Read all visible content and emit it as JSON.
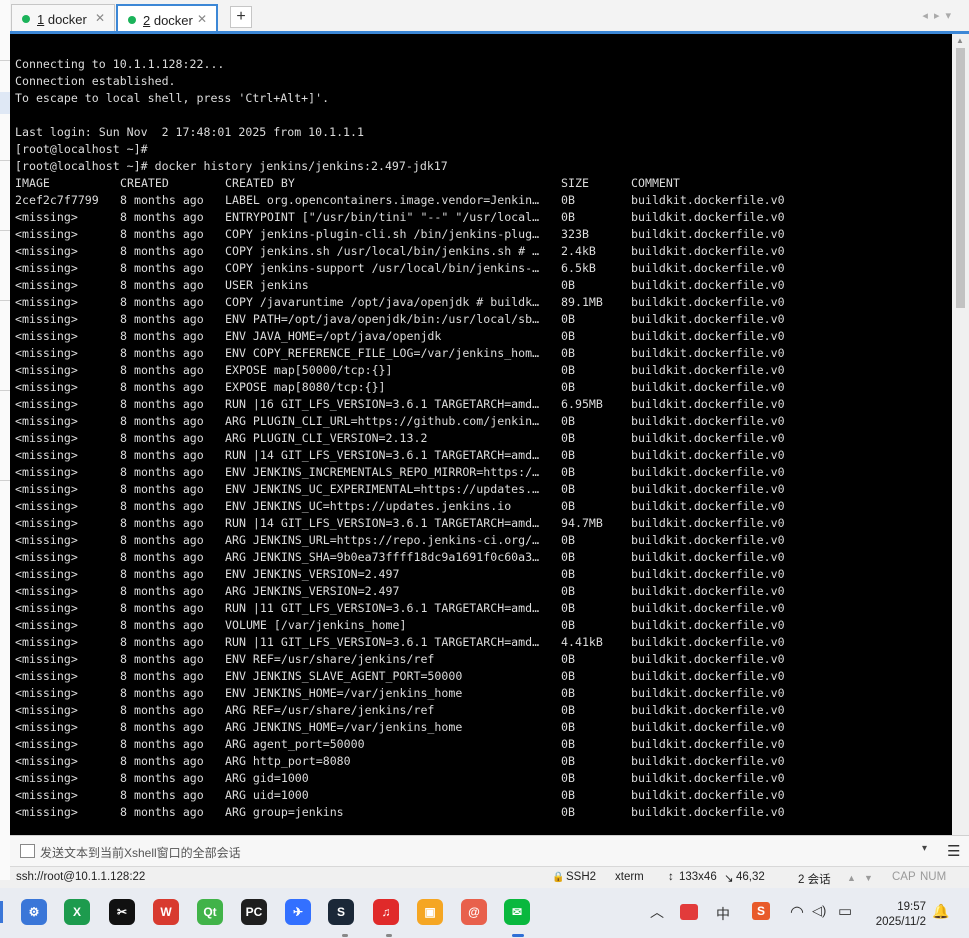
{
  "tabs": [
    {
      "num": "1",
      "label": " docker",
      "close": "✕"
    },
    {
      "num": "2",
      "label": " docker",
      "close": "✕"
    }
  ],
  "add_tab": "+",
  "tab_nav": "◂▸▾",
  "terminal": {
    "preamble": [
      "Connecting to 10.1.1.128:22...",
      "Connection established.",
      "To escape to local shell, press 'Ctrl+Alt+]'.",
      "",
      "Last login: Sun Nov  2 17:48:01 2025 from 10.1.1.1",
      "[root@localhost ~]#",
      "[root@localhost ~]# docker history jenkins/jenkins:2.497-jdk17"
    ],
    "headers": [
      "IMAGE",
      "CREATED",
      "CREATED BY",
      "SIZE",
      "COMMENT"
    ],
    "rows": [
      [
        "2cef2c7f7799",
        "8 months ago",
        "LABEL org.opencontainers.image.vendor=Jenkin…",
        "0B",
        "buildkit.dockerfile.v0"
      ],
      [
        "<missing>",
        "8 months ago",
        "ENTRYPOINT [\"/usr/bin/tini\" \"--\" \"/usr/local…",
        "0B",
        "buildkit.dockerfile.v0"
      ],
      [
        "<missing>",
        "8 months ago",
        "COPY jenkins-plugin-cli.sh /bin/jenkins-plug…",
        "323B",
        "buildkit.dockerfile.v0"
      ],
      [
        "<missing>",
        "8 months ago",
        "COPY jenkins.sh /usr/local/bin/jenkins.sh # …",
        "2.4kB",
        "buildkit.dockerfile.v0"
      ],
      [
        "<missing>",
        "8 months ago",
        "COPY jenkins-support /usr/local/bin/jenkins-…",
        "6.5kB",
        "buildkit.dockerfile.v0"
      ],
      [
        "<missing>",
        "8 months ago",
        "USER jenkins",
        "0B",
        "buildkit.dockerfile.v0"
      ],
      [
        "<missing>",
        "8 months ago",
        "COPY /javaruntime /opt/java/openjdk # buildk…",
        "89.1MB",
        "buildkit.dockerfile.v0"
      ],
      [
        "<missing>",
        "8 months ago",
        "ENV PATH=/opt/java/openjdk/bin:/usr/local/sb…",
        "0B",
        "buildkit.dockerfile.v0"
      ],
      [
        "<missing>",
        "8 months ago",
        "ENV JAVA_HOME=/opt/java/openjdk",
        "0B",
        "buildkit.dockerfile.v0"
      ],
      [
        "<missing>",
        "8 months ago",
        "ENV COPY_REFERENCE_FILE_LOG=/var/jenkins_hom…",
        "0B",
        "buildkit.dockerfile.v0"
      ],
      [
        "<missing>",
        "8 months ago",
        "EXPOSE map[50000/tcp:{}]",
        "0B",
        "buildkit.dockerfile.v0"
      ],
      [
        "<missing>",
        "8 months ago",
        "EXPOSE map[8080/tcp:{}]",
        "0B",
        "buildkit.dockerfile.v0"
      ],
      [
        "<missing>",
        "8 months ago",
        "RUN |16 GIT_LFS_VERSION=3.6.1 TARGETARCH=amd…",
        "6.95MB",
        "buildkit.dockerfile.v0"
      ],
      [
        "<missing>",
        "8 months ago",
        "ARG PLUGIN_CLI_URL=https://github.com/jenkin…",
        "0B",
        "buildkit.dockerfile.v0"
      ],
      [
        "<missing>",
        "8 months ago",
        "ARG PLUGIN_CLI_VERSION=2.13.2",
        "0B",
        "buildkit.dockerfile.v0"
      ],
      [
        "<missing>",
        "8 months ago",
        "RUN |14 GIT_LFS_VERSION=3.6.1 TARGETARCH=amd…",
        "0B",
        "buildkit.dockerfile.v0"
      ],
      [
        "<missing>",
        "8 months ago",
        "ENV JENKINS_INCREMENTALS_REPO_MIRROR=https:/…",
        "0B",
        "buildkit.dockerfile.v0"
      ],
      [
        "<missing>",
        "8 months ago",
        "ENV JENKINS_UC_EXPERIMENTAL=https://updates.…",
        "0B",
        "buildkit.dockerfile.v0"
      ],
      [
        "<missing>",
        "8 months ago",
        "ENV JENKINS_UC=https://updates.jenkins.io",
        "0B",
        "buildkit.dockerfile.v0"
      ],
      [
        "<missing>",
        "8 months ago",
        "RUN |14 GIT_LFS_VERSION=3.6.1 TARGETARCH=amd…",
        "94.7MB",
        "buildkit.dockerfile.v0"
      ],
      [
        "<missing>",
        "8 months ago",
        "ARG JENKINS_URL=https://repo.jenkins-ci.org/…",
        "0B",
        "buildkit.dockerfile.v0"
      ],
      [
        "<missing>",
        "8 months ago",
        "ARG JENKINS_SHA=9b0ea73ffff18dc9a1691f0c60a3…",
        "0B",
        "buildkit.dockerfile.v0"
      ],
      [
        "<missing>",
        "8 months ago",
        "ENV JENKINS_VERSION=2.497",
        "0B",
        "buildkit.dockerfile.v0"
      ],
      [
        "<missing>",
        "8 months ago",
        "ARG JENKINS_VERSION=2.497",
        "0B",
        "buildkit.dockerfile.v0"
      ],
      [
        "<missing>",
        "8 months ago",
        "RUN |11 GIT_LFS_VERSION=3.6.1 TARGETARCH=amd…",
        "0B",
        "buildkit.dockerfile.v0"
      ],
      [
        "<missing>",
        "8 months ago",
        "VOLUME [/var/jenkins_home]",
        "0B",
        "buildkit.dockerfile.v0"
      ],
      [
        "<missing>",
        "8 months ago",
        "RUN |11 GIT_LFS_VERSION=3.6.1 TARGETARCH=amd…",
        "4.41kB",
        "buildkit.dockerfile.v0"
      ],
      [
        "<missing>",
        "8 months ago",
        "ENV REF=/usr/share/jenkins/ref",
        "0B",
        "buildkit.dockerfile.v0"
      ],
      [
        "<missing>",
        "8 months ago",
        "ENV JENKINS_SLAVE_AGENT_PORT=50000",
        "0B",
        "buildkit.dockerfile.v0"
      ],
      [
        "<missing>",
        "8 months ago",
        "ENV JENKINS_HOME=/var/jenkins_home",
        "0B",
        "buildkit.dockerfile.v0"
      ],
      [
        "<missing>",
        "8 months ago",
        "ARG REF=/usr/share/jenkins/ref",
        "0B",
        "buildkit.dockerfile.v0"
      ],
      [
        "<missing>",
        "8 months ago",
        "ARG JENKINS_HOME=/var/jenkins_home",
        "0B",
        "buildkit.dockerfile.v0"
      ],
      [
        "<missing>",
        "8 months ago",
        "ARG agent_port=50000",
        "0B",
        "buildkit.dockerfile.v0"
      ],
      [
        "<missing>",
        "8 months ago",
        "ARG http_port=8080",
        "0B",
        "buildkit.dockerfile.v0"
      ],
      [
        "<missing>",
        "8 months ago",
        "ARG gid=1000",
        "0B",
        "buildkit.dockerfile.v0"
      ],
      [
        "<missing>",
        "8 months ago",
        "ARG uid=1000",
        "0B",
        "buildkit.dockerfile.v0"
      ],
      [
        "<missing>",
        "8 months ago",
        "ARG group=jenkins",
        "0B",
        "buildkit.dockerfile.v0"
      ]
    ]
  },
  "compose": {
    "text": "发送文本到当前Xshell窗口的全部会话",
    "dropdown": "▾",
    "menu": "☰"
  },
  "status": {
    "connection": "ssh://root@10.1.1.128:22",
    "protocol": "SSH2",
    "term_type": "xterm",
    "size": "133x46",
    "cursor": "46,32",
    "sessions": "2 会话",
    "caps": "CAP",
    "num": "NUM",
    "lock_icon": "🔒",
    "size_icon": "↕",
    "cursor_icon": "↘",
    "up_arrow": "▲",
    "down_arrow": "▼"
  },
  "taskbar": {
    "apps": [
      {
        "name": "settings-app-icon",
        "glyph": "⚙",
        "color": "#3a76d8"
      },
      {
        "name": "xshell-app-icon",
        "glyph": "X",
        "color": "#1d9b4e"
      },
      {
        "name": "capcut-app-icon",
        "glyph": "✂",
        "color": "#111111"
      },
      {
        "name": "wps-app-icon",
        "glyph": "W",
        "color": "#d83a2f"
      },
      {
        "name": "qt-app-icon",
        "glyph": "Qt",
        "color": "#41b349"
      },
      {
        "name": "pycharm-app-icon",
        "glyph": "PC",
        "color": "#1f1f1f"
      },
      {
        "name": "feishu-app-icon",
        "glyph": "✈",
        "color": "#3370ff"
      },
      {
        "name": "steam-app-icon",
        "glyph": "S",
        "color": "#1b2838"
      },
      {
        "name": "netease-music-app-icon",
        "glyph": "♫",
        "color": "#e02a2a"
      },
      {
        "name": "windows-tool-app-icon",
        "glyph": "▣",
        "color": "#f5a623"
      },
      {
        "name": "snail-app-icon",
        "glyph": "@",
        "color": "#e8604c"
      },
      {
        "name": "wechat-app-icon",
        "glyph": "✉",
        "color": "#09b83e"
      }
    ],
    "tray": {
      "chevron": "︿",
      "ime": "中",
      "wps_s": "S",
      "wifi": "◠",
      "volume": "◁)",
      "battery": "▭",
      "bell": "🔔"
    },
    "time": "19:57",
    "date": "2025/11/2"
  }
}
